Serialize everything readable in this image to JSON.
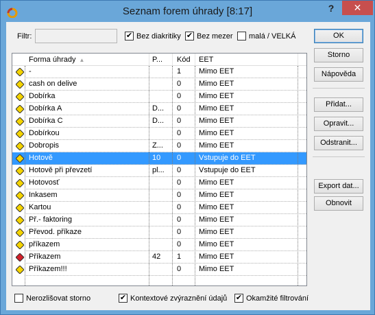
{
  "window": {
    "title": "Seznam forem úhrady  [8:17]",
    "help_label": "?",
    "close_label": "✕"
  },
  "filter": {
    "label": "Filtr:",
    "value": "",
    "checkboxes": [
      {
        "label": "Bez diakritiky",
        "checked": true
      },
      {
        "label": "Bez mezer",
        "checked": true
      },
      {
        "label": "malá / VELKÁ",
        "checked": false
      }
    ]
  },
  "grid": {
    "columns": [
      "Forma úhrady",
      "P...",
      "Kód",
      "EET"
    ],
    "rows": [
      {
        "name": "-",
        "p": "",
        "kod": "1",
        "eet": "Mimo EET",
        "icon": "yellow",
        "selected": false
      },
      {
        "name": "cash on  delive",
        "p": "",
        "kod": "0",
        "eet": "Mimo EET",
        "icon": "yellow",
        "selected": false
      },
      {
        "name": "Dobírka",
        "p": "",
        "kod": "0",
        "eet": "Mimo EET",
        "icon": "yellow",
        "selected": false
      },
      {
        "name": "Dobírka A",
        "p": "D...",
        "kod": "0",
        "eet": "Mimo EET",
        "icon": "yellow",
        "selected": false
      },
      {
        "name": "Dobírka C",
        "p": "D...",
        "kod": "0",
        "eet": "Mimo EET",
        "icon": "yellow",
        "selected": false
      },
      {
        "name": "Dobírkou",
        "p": "",
        "kod": "0",
        "eet": "Mimo EET",
        "icon": "yellow",
        "selected": false
      },
      {
        "name": "Dobropis",
        "p": "Z...",
        "kod": "0",
        "eet": "Mimo EET",
        "icon": "yellow",
        "selected": false
      },
      {
        "name": "Hotově",
        "p": "10",
        "kod": "0",
        "eet": "Vstupuje do EET",
        "icon": "yellow",
        "selected": true
      },
      {
        "name": "Hotově při převzetí",
        "p": "pl...",
        "kod": "0",
        "eet": "Vstupuje do EET",
        "icon": "yellow",
        "selected": false
      },
      {
        "name": "Hotovosť",
        "p": "",
        "kod": "0",
        "eet": "Mimo EET",
        "icon": "yellow",
        "selected": false
      },
      {
        "name": "Inkasem",
        "p": "",
        "kod": "0",
        "eet": "Mimo EET",
        "icon": "yellow",
        "selected": false
      },
      {
        "name": "Kartou",
        "p": "",
        "kod": "0",
        "eet": "Mimo EET",
        "icon": "yellow",
        "selected": false
      },
      {
        "name": "Př.- faktoring",
        "p": "",
        "kod": "0",
        "eet": "Mimo EET",
        "icon": "yellow",
        "selected": false
      },
      {
        "name": "Převod. příkaze",
        "p": "",
        "kod": "0",
        "eet": "Mimo EET",
        "icon": "yellow",
        "selected": false
      },
      {
        "name": "příkazem",
        "p": "",
        "kod": "0",
        "eet": "Mimo EET",
        "icon": "yellow",
        "selected": false
      },
      {
        "name": "Příkazem",
        "p": "42",
        "kod": "1",
        "eet": "Mimo EET",
        "icon": "red",
        "selected": false
      },
      {
        "name": "Příkazem!!!",
        "p": "",
        "kod": "0",
        "eet": "Mimo EET",
        "icon": "yellow",
        "selected": false
      }
    ]
  },
  "buttons": {
    "ok": "OK",
    "storno": "Storno",
    "napoveda": "Nápověda",
    "pridat": "Přidat...",
    "opravit": "Opravit...",
    "odstranit": "Odstranit...",
    "export": "Export dat...",
    "obnovit": "Obnovit"
  },
  "bottom": [
    {
      "label": "Nerozlišovat storno",
      "checked": false
    },
    {
      "label": "Kontextové zvýraznění údajů",
      "checked": true
    },
    {
      "label": "Okamžité filtrování",
      "checked": true
    }
  ],
  "colors": {
    "selection": "#3399ff",
    "titlebar": "#6aa7d9",
    "close": "#c74f4e",
    "icon_yellow": "#f5d400",
    "icon_red": "#d2202a"
  }
}
